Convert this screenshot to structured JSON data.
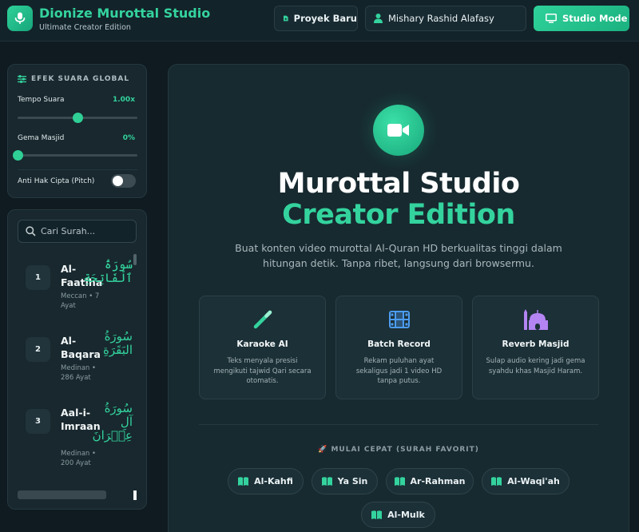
{
  "header": {
    "app_title": "Dionize Murottal Studio",
    "app_subtitle": "Ultimate Creator Edition",
    "new_project_label": "Proyek Baru",
    "reciter_label": "Mishary Rashid Alafasy",
    "studio_mode_label": "Studio Mode"
  },
  "effects": {
    "title": "EFEK SUARA GLOBAL",
    "tempo": {
      "label": "Tempo Suara",
      "value": "1.00x",
      "level": 0.5
    },
    "echo": {
      "label": "Gema Masjid",
      "value": "0%",
      "level": 0.0
    },
    "anti_copyright": {
      "label": "Anti Hak Cipta (Pitch)",
      "enabled": false
    }
  },
  "surah_list": {
    "search_placeholder": "Cari Surah...",
    "items": [
      {
        "number": "1",
        "name": "Al-Faatiha",
        "meta": "Meccan • 7 Ayat",
        "arabic": "سُورَةُ ٱلْفَاتِحَةِ"
      },
      {
        "number": "2",
        "name": "Al-Baqara",
        "meta": "Medinan • 286 Ayat",
        "arabic": "سُورَةُ البَقَرَةِ"
      },
      {
        "number": "3",
        "name": "Aal-i-Imraan",
        "meta": "Medinan • 200 Ayat",
        "arabic": "سُورَةُ آلِ عِمۡرَانَ"
      }
    ]
  },
  "hero": {
    "title_line1": "Murottal Studio",
    "title_line2": "Creator Edition",
    "description": "Buat konten video murottal Al-Quran HD berkualitas tinggi dalam hitungan detik. Tanpa ribet, langsung dari browsermu."
  },
  "features": [
    {
      "icon": "wand-icon",
      "title": "Karaoke AI",
      "desc": "Teks menyala presisi mengikuti tajwid Qari secara otomatis.",
      "color": "#34d39e"
    },
    {
      "icon": "film-icon",
      "title": "Batch Record",
      "desc": "Rekam puluhan ayat sekaligus jadi 1 video HD tanpa putus.",
      "color": "#4c9cf0"
    },
    {
      "icon": "mosque-icon",
      "title": "Reverb Masjid",
      "desc": "Sulap audio kering jadi gema syahdu khas Masjid Haram.",
      "color": "#b384f2"
    }
  ],
  "quick_start": {
    "title": "🚀 MULAI CEPAT (SURAH FAVORIT)",
    "chips": [
      "Al-Kahfi",
      "Ya Sin",
      "Ar-Rahman",
      "Al-Waqi'ah",
      "Al-Mulk"
    ]
  },
  "colors": {
    "accent": "#34d39e",
    "background": "#0f1b20",
    "panel": "#18282e"
  }
}
